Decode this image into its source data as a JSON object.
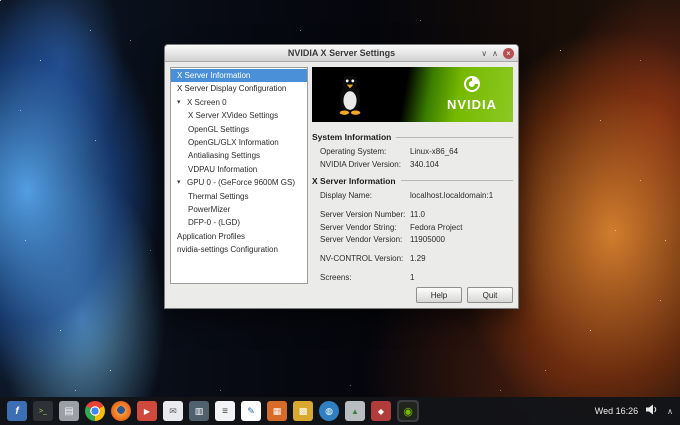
{
  "window": {
    "title": "NVIDIA X Server Settings",
    "controls": {
      "minimize": "∨",
      "maximize": "∧",
      "close": "×"
    },
    "selection_color": "#4a90d9",
    "nvidia_green": "#76b900",
    "sidebar": {
      "expander_glyph": "▾",
      "items": [
        {
          "label": "X Server Information",
          "level": 0,
          "selected": true
        },
        {
          "label": "X Server Display Configuration",
          "level": 0
        },
        {
          "label": "X Screen 0",
          "level": 0,
          "expanded": true
        },
        {
          "label": "X Server XVideo Settings",
          "level": 1
        },
        {
          "label": "OpenGL Settings",
          "level": 1
        },
        {
          "label": "OpenGL/GLX Information",
          "level": 1
        },
        {
          "label": "Antialiasing Settings",
          "level": 1
        },
        {
          "label": "VDPAU Information",
          "level": 1
        },
        {
          "label": "GPU 0 - (GeForce 9600M GS)",
          "level": 0,
          "expanded": true
        },
        {
          "label": "Thermal Settings",
          "level": 1
        },
        {
          "label": "PowerMizer",
          "level": 1
        },
        {
          "label": "DFP-0 - (LGD)",
          "level": 1
        },
        {
          "label": "Application Profiles",
          "level": 0
        },
        {
          "label": "nvidia-settings Configuration",
          "level": 0
        }
      ]
    },
    "content": {
      "banner": {
        "brand": "NVIDIA"
      },
      "sections": [
        {
          "title": "System Information",
          "rows": [
            {
              "label": "Operating System:",
              "value": "Linux-x86_64"
            },
            {
              "label": "NVIDIA Driver Version:",
              "value": "340.104"
            }
          ]
        },
        {
          "title": "X Server Information",
          "rows": [
            {
              "label": "Display Name:",
              "value": "localhost.localdomain:1"
            },
            {
              "label": "Server Version Number:",
              "value": "11.0"
            },
            {
              "label": "Server Vendor String:",
              "value": "Fedora Project"
            },
            {
              "label": "Server Vendor Version:",
              "value": "11905000"
            },
            {
              "label": "NV-CONTROL Version:",
              "value": "1.29"
            },
            {
              "label": "Screens:",
              "value": "1"
            }
          ]
        }
      ],
      "buttons": [
        {
          "label": "Help"
        },
        {
          "label": "Quit"
        }
      ]
    }
  },
  "panel": {
    "clock": "Wed 16:26",
    "caret_glyph": "∧",
    "icons": [
      {
        "name": "applications-menu",
        "glyph": "f"
      },
      {
        "name": "terminal",
        "glyph": ">_"
      },
      {
        "name": "file-manager",
        "glyph": "▤"
      },
      {
        "name": "chrome-browser",
        "glyph": ""
      },
      {
        "name": "firefox-browser",
        "glyph": ""
      },
      {
        "name": "media-player",
        "glyph": "▶"
      },
      {
        "name": "mail-client",
        "glyph": "✉"
      },
      {
        "name": "system-monitor",
        "glyph": "▥"
      },
      {
        "name": "text-editor",
        "glyph": "≡"
      },
      {
        "name": "word-processor",
        "glyph": "✎"
      },
      {
        "name": "presentation-app",
        "glyph": "▦"
      },
      {
        "name": "spreadsheet-app",
        "glyph": "▩"
      },
      {
        "name": "web-browser",
        "glyph": "◍"
      },
      {
        "name": "image-viewer",
        "glyph": "▲"
      },
      {
        "name": "package-manager",
        "glyph": "◆"
      },
      {
        "name": "nvidia-settings",
        "glyph": "◉",
        "active": true
      }
    ]
  }
}
